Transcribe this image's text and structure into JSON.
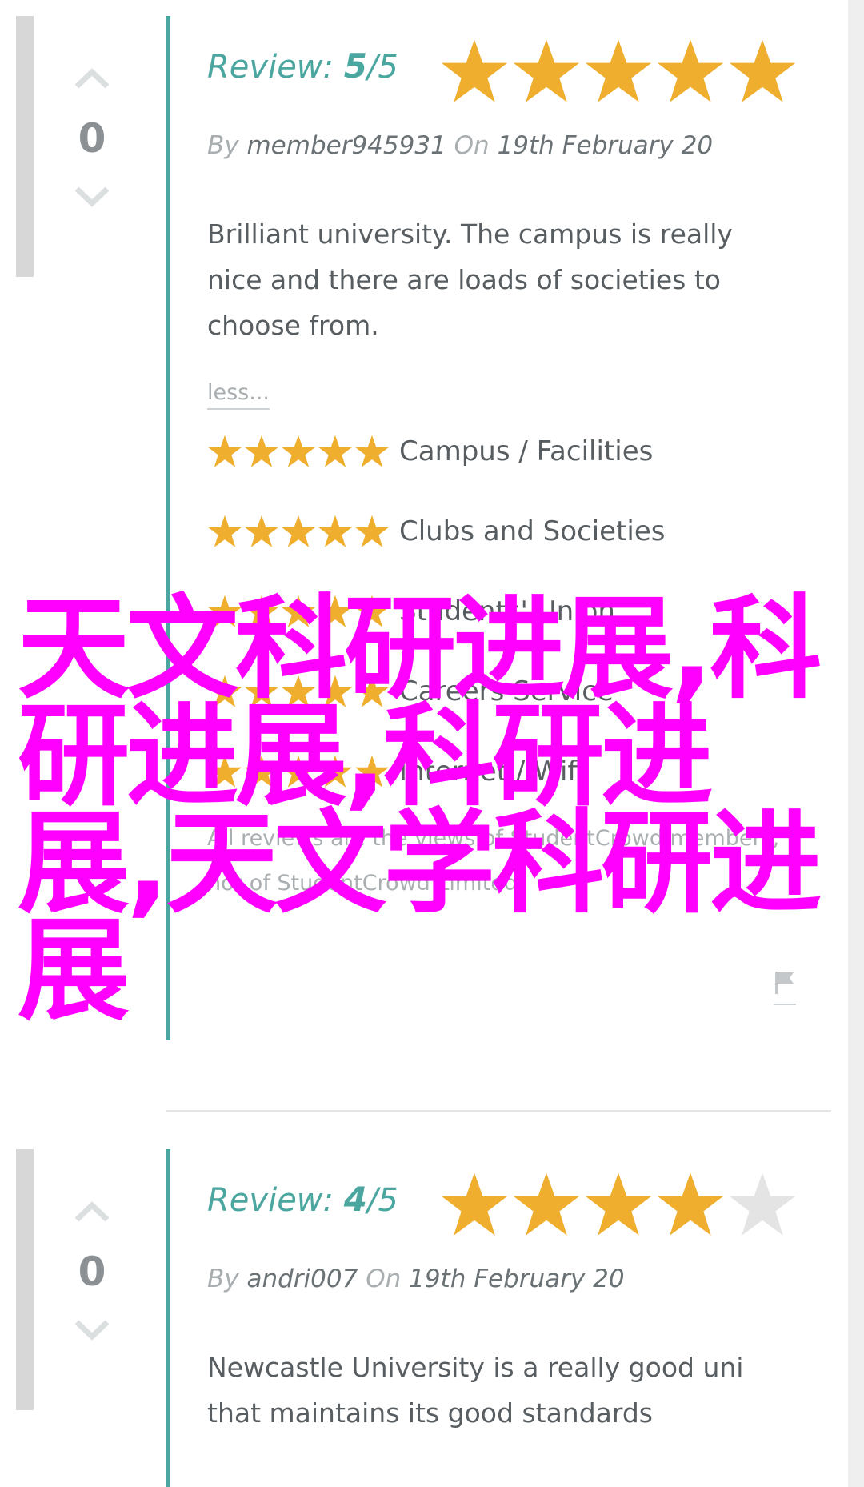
{
  "reviews": [
    {
      "label": "Review:",
      "score": "5",
      "out_of": "/5",
      "rating_fraction": 1.0,
      "votes": "0",
      "by_label": "By",
      "author": "member945931",
      "on_label": "On",
      "date": "19th February 20",
      "text": "Brilliant university. The campus is really nice and there are loads of societies to choose from.",
      "less_label": "less...",
      "categories": [
        {
          "label": "Campus / Facilities",
          "stars": 5
        },
        {
          "label": "Clubs and Societies",
          "stars": 5
        },
        {
          "label": "Students' Union",
          "stars": 5
        },
        {
          "label": "Careers Service",
          "stars": 5
        },
        {
          "label": "Internet / Wifi",
          "stars": 5
        }
      ],
      "disclaimer": "All reviews are the views of StudentCrowd members, not of StudentCrowd Limited"
    },
    {
      "label": "Review:",
      "score": "4",
      "out_of": "/5",
      "rating_fraction": 0.8,
      "votes": "0",
      "by_label": "By",
      "author": "andri007",
      "on_label": "On",
      "date": "19th February 20",
      "text": "Newcastle University is a really good uni that maintains its good standards"
    }
  ],
  "overlay_text": "天文科研进展,科研进展,科研进展,天文学科研进展",
  "colors": {
    "teal": "#4aa69f",
    "star_gold": "#f0ae2e",
    "star_empty": "#e4e4e4",
    "overlay": "#ff00ff"
  }
}
